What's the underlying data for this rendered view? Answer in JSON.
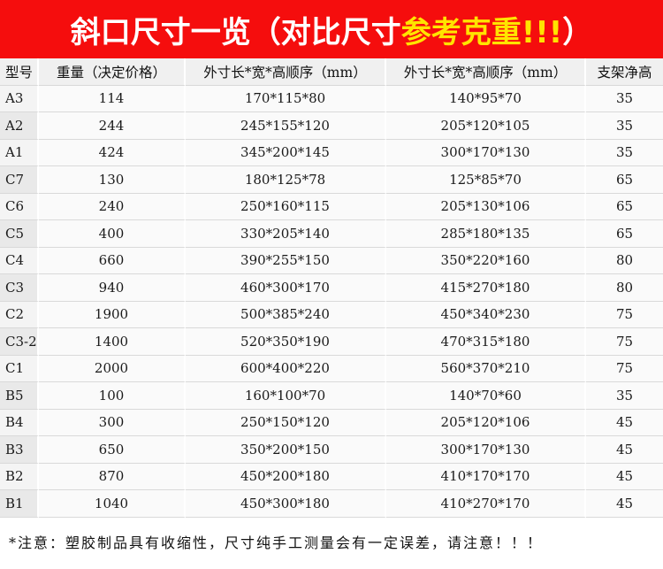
{
  "banner": {
    "main": "斜口尺寸一览（对比尺寸 ",
    "accent": "参考克重!!!",
    "close": "）"
  },
  "headers": [
    "型号",
    "重量（决定价格）",
    "外寸长*宽*高顺序（mm）",
    "外寸长*宽*高顺序（mm）",
    "支架净高"
  ],
  "rows": [
    [
      "A3",
      "114",
      "170*115*80",
      "140*95*70",
      "35"
    ],
    [
      "A2",
      "244",
      "245*155*120",
      "205*120*105",
      "35"
    ],
    [
      "A1",
      "424",
      "345*200*145",
      "300*170*130",
      "35"
    ],
    [
      "C7",
      "130",
      "180*125*78",
      "125*85*70",
      "65"
    ],
    [
      "C6",
      "240",
      "250*160*115",
      "205*130*106",
      "65"
    ],
    [
      "C5",
      "400",
      "330*205*140",
      "285*180*135",
      "65"
    ],
    [
      "C4",
      "660",
      "390*255*150",
      "350*220*160",
      "80"
    ],
    [
      "C3",
      "940",
      "460*300*170",
      "415*270*180",
      "80"
    ],
    [
      "C2",
      "1900",
      "500*385*240",
      "450*340*230",
      "75"
    ],
    [
      "C3-2",
      "1400",
      "520*350*190",
      "470*315*180",
      "75"
    ],
    [
      "C1",
      "2000",
      "600*400*220",
      "560*370*210",
      "75"
    ],
    [
      "B5",
      "100",
      "160*100*70",
      "140*70*60",
      "35"
    ],
    [
      "B4",
      "300",
      "250*150*120",
      "205*120*106",
      "45"
    ],
    [
      "B3",
      "650",
      "350*200*150",
      "300*170*130",
      "45"
    ],
    [
      "B2",
      "870",
      "450*200*180",
      "410*170*170",
      "45"
    ],
    [
      "B1",
      "1040",
      "450*300*180",
      "410*270*170",
      "45"
    ]
  ],
  "footer": "*注意：塑胶制品具有收缩性，尺寸纯手工测量会有一定误差，请注意！！！"
}
